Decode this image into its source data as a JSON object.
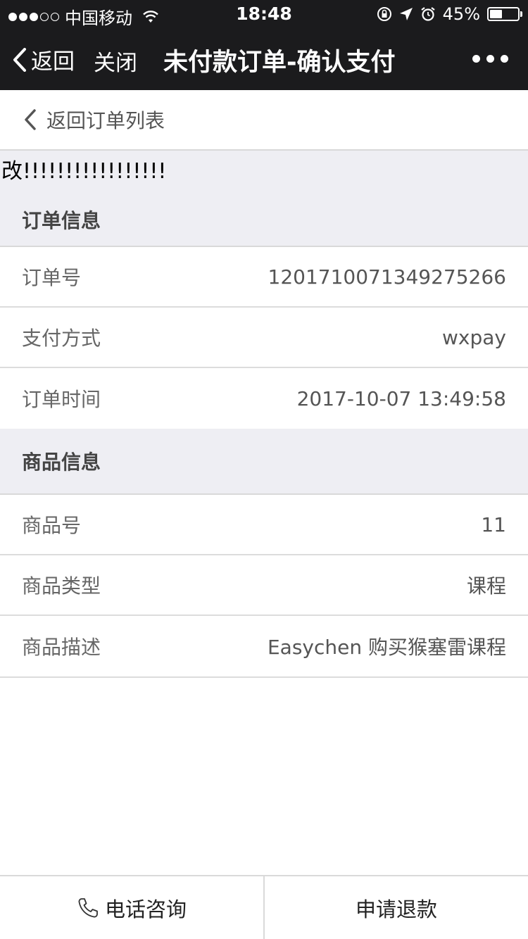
{
  "status_bar": {
    "carrier": "中国移动",
    "time": "18:48",
    "battery": "45%",
    "battery_level": 0.45,
    "icons": [
      "signal-dots-icon",
      "wifi-icon",
      "orientation-lock-icon",
      "location-arrow-icon",
      "alarm-icon",
      "battery-icon"
    ]
  },
  "nav": {
    "back_label": "返回",
    "close_label": "关闭",
    "title": "未付款订单-确认支付",
    "more_icon": "more-dots-icon"
  },
  "subheader": {
    "back_link_label": "返回订单列表"
  },
  "notice": "改!!!!!!!!!!!!!!!!!",
  "order_info": {
    "title": "订单信息",
    "rows": [
      {
        "label": "订单号",
        "value": "1201710071349275266"
      },
      {
        "label": "支付方式",
        "value": "wxpay"
      },
      {
        "label": "订单时间",
        "value": "2017-10-07 13:49:58"
      }
    ]
  },
  "product_info": {
    "title": "商品信息",
    "rows": [
      {
        "label": "商品号",
        "value": "11"
      },
      {
        "label": "商品类型",
        "value": "课程"
      },
      {
        "label": "商品描述",
        "value": "Easychen 购买猴塞雷课程"
      }
    ]
  },
  "bottom_bar": {
    "phone_label": "电话咨询",
    "refund_label": "申请退款"
  }
}
